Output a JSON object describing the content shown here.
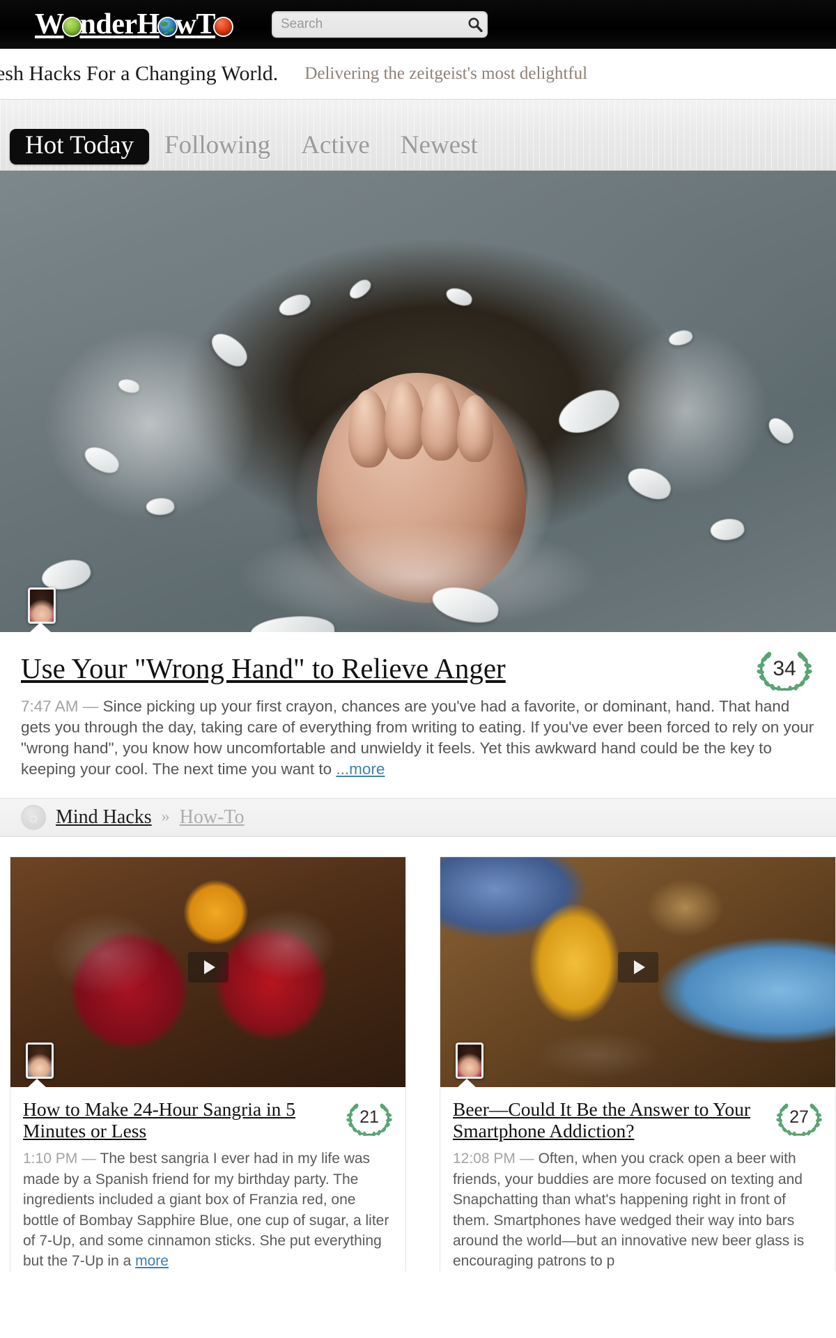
{
  "site": {
    "logo_text": [
      "W",
      "nder",
      "H",
      "w",
      "T",
      ""
    ],
    "logo_name": "WonderHowTo",
    "colors": {
      "dot_green": "#8dc63f",
      "dot_globe": "#2f7fc0",
      "dot_red": "#e8401a",
      "link": "#3c7fb0",
      "laurel": "#4f9b6a"
    }
  },
  "search": {
    "value": "",
    "placeholder": "Search",
    "icon": "search-icon"
  },
  "tagline": {
    "headline": "resh Hacks For a Changing World.",
    "subline": "Delivering the zeitgeist's most delightful"
  },
  "nav": {
    "tabs": [
      {
        "label": "Hot Today",
        "active": true
      },
      {
        "label": "Following",
        "active": false
      },
      {
        "label": "Active",
        "active": false
      },
      {
        "label": "Newest",
        "active": false
      }
    ]
  },
  "hero": {
    "image_alt": "fist punching through a wall",
    "avatar": "user-avatar",
    "title": "Use Your \"Wrong Hand\" to Relieve Anger",
    "score": "34",
    "timestamp": "7:47 AM",
    "dash": "—",
    "body": "Since picking up your first crayon, chances are you've had a favorite, or dominant, hand. That hand gets you through the day, taking care of everything from writing to eating. If you've ever been forced to rely on your \"wrong hand\", you know how uncomfortable and unwieldy it feels. Yet this awkward hand could be the key to keeping your cool. The next time you want to",
    "more_label": "...more",
    "category": {
      "icon": "mind-hacks-icon",
      "name": "Mind Hacks",
      "separator": "»",
      "subcategory": "How-To"
    }
  },
  "cards": [
    {
      "image_alt": "sangria in jar and glass",
      "has_video": true,
      "play_icon": "play-icon",
      "avatar": "user-avatar",
      "title": "How to Make 24-Hour Sangria in 5 Minutes or Less",
      "score": "21",
      "timestamp": "1:10 PM",
      "dash": "—",
      "body": "The best sangria I ever had in my life was made by a Spanish friend for my birthday party. The ingredients included a giant box of Franzia red, one bottle of Bombay Sapphire Blue, one cup of sugar, a liter of 7-Up, and some cinnamon sticks. She put everything but the 7-Up in a",
      "more_label": "more"
    },
    {
      "image_alt": "beer glass and smartphone on a bar",
      "has_video": true,
      "play_icon": "play-icon",
      "avatar": "user-avatar",
      "title": "Beer—Could It Be the Answer to Your Smartphone Addiction?",
      "score": "27",
      "timestamp": "12:08 PM",
      "dash": "—",
      "body": "Often, when you crack open a beer with friends, your buddies are more focused on texting and Snapchatting than what's happening right in front of them. Smartphones have wedged their way into bars around the world—but an innovative new beer glass is encouraging patrons to p",
      "more_label": ""
    }
  ]
}
